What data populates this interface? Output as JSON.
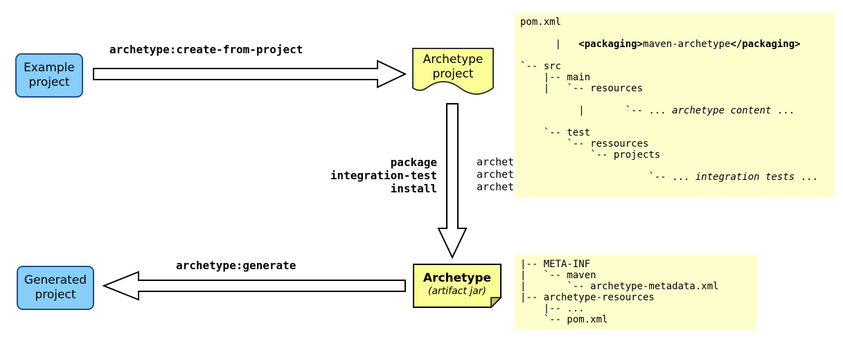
{
  "nodes": {
    "example": {
      "line1": "Example",
      "line2": "project"
    },
    "archetypeProject": {
      "line1": "Archetype",
      "line2": "project"
    },
    "archetypeJar": {
      "title": "Archetype",
      "sub": "(artifact jar)"
    },
    "generated": {
      "line1": "Generated",
      "line2": "project"
    }
  },
  "arrows": {
    "createFromProject": "archetype:create-from-project",
    "generate": "archetype:generate",
    "leftBold": "package\nintegration-test\ninstall",
    "rightPlain": "archetype:jar\narchetype:integration-test\narchetype:update-local-catalog"
  },
  "trees": {
    "project": {
      "l1": "pom.xml",
      "l2a": "|   ",
      "l2b": "<packaging>",
      "l2c": "maven-archetype",
      "l2d": "</packaging>",
      "l3": "`-- src",
      "l4": "    |-- main",
      "l5": "    |   `-- resources",
      "l6a": "    |       `-- ... ",
      "l6b": "archetype content",
      "l6c": " ...",
      "l7": "    `-- test",
      "l8": "        `-- ressources",
      "l9": "            `-- projects",
      "l10a": "                `-- ... ",
      "l10b": "integration tests",
      "l10c": " ..."
    },
    "jar": {
      "l1": "|-- META-INF",
      "l2": "|   `-- maven",
      "l3": "|       `-- archetype-metadata.xml",
      "l4": "|-- archetype-resources",
      "l5": "    |-- ...",
      "l6": "    `-- pom.xml"
    }
  }
}
